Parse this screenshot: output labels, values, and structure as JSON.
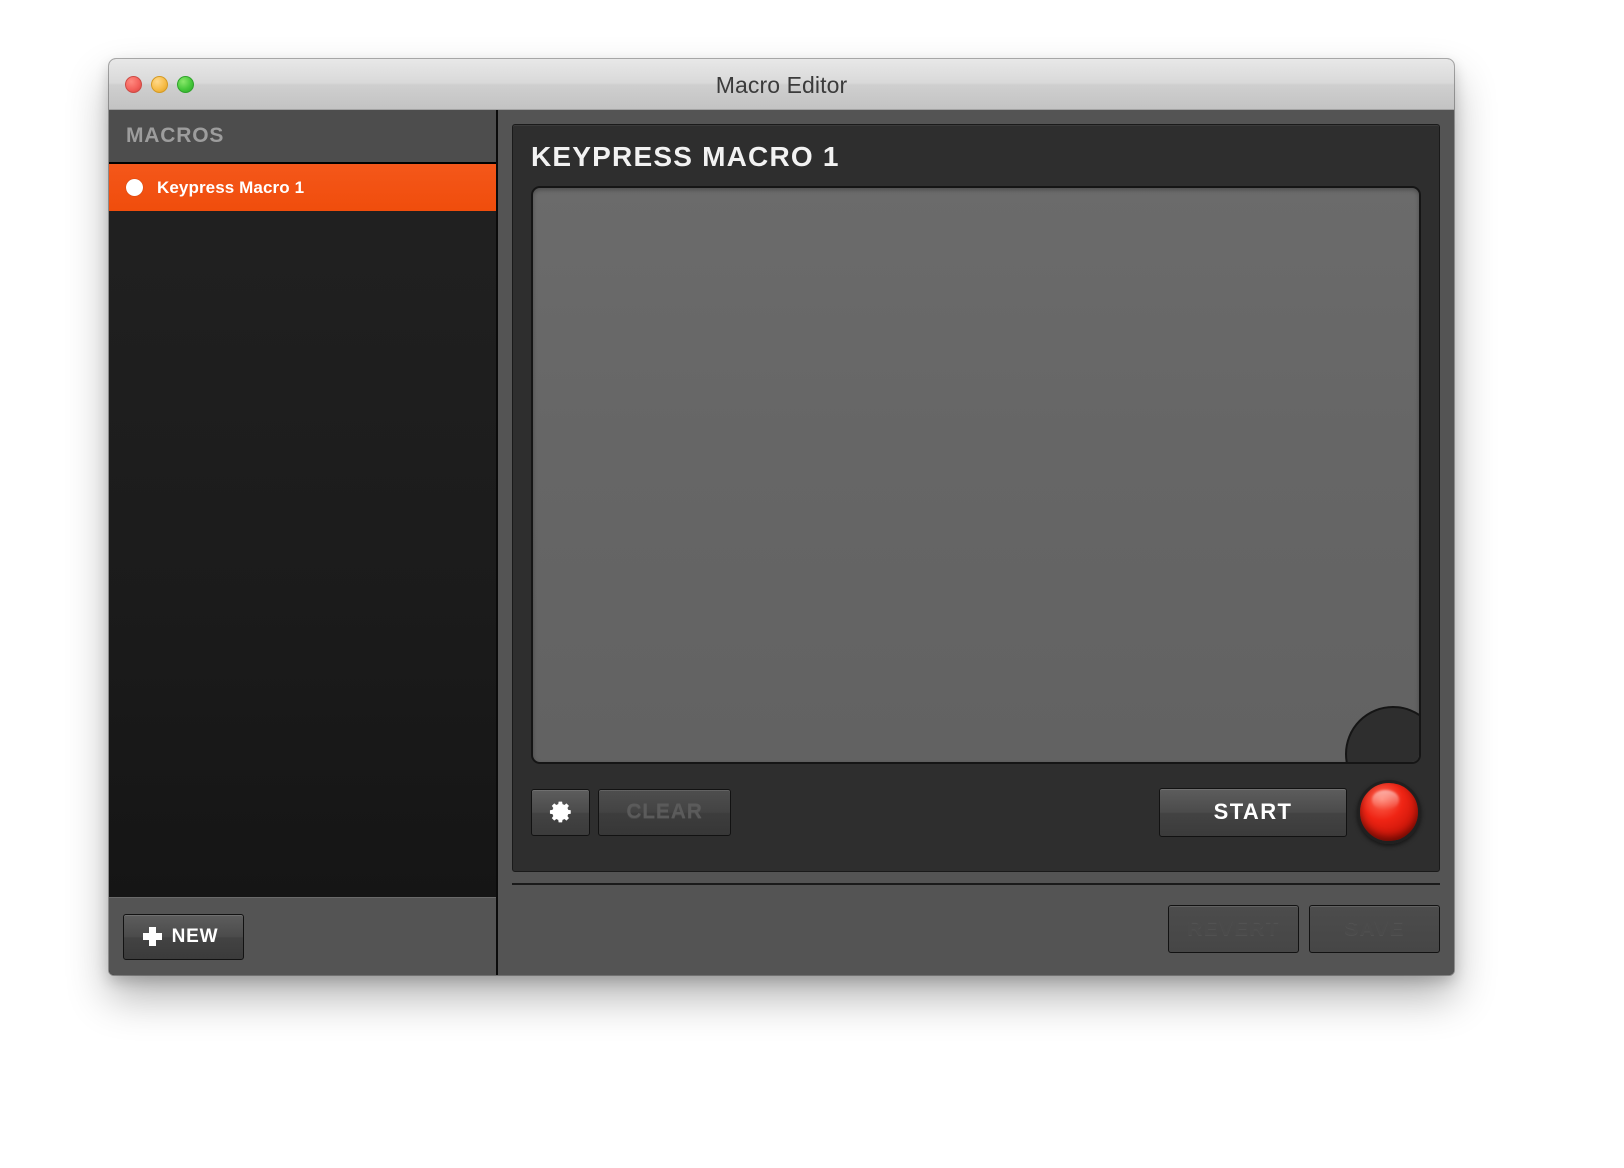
{
  "window": {
    "title": "Macro Editor",
    "traffic_lights": [
      {
        "name": "close",
        "color": "#f4625c"
      },
      {
        "name": "minimize",
        "color": "#f7bd4a"
      },
      {
        "name": "maximize",
        "color": "#47c83b"
      }
    ]
  },
  "sidebar": {
    "header_label": "MACROS",
    "items": [
      {
        "label": "Keypress Macro 1",
        "selected": true,
        "icon": "circle-dot-icon"
      }
    ],
    "new_button": {
      "label": "NEW",
      "icon": "plus-icon"
    },
    "selected_color": "#f04d0c"
  },
  "main": {
    "panel_title": "KEYPRESS MACRO 1",
    "content_area": {
      "text": "",
      "background": "#666666"
    },
    "toolbar": {
      "settings_button": {
        "label": "",
        "icon": "gear-icon",
        "enabled": true
      },
      "clear_button": {
        "label": "CLEAR",
        "enabled": false
      },
      "start_button": {
        "label": "START",
        "enabled": true
      },
      "record_button": {
        "label": "",
        "icon": "record-circle-icon",
        "color": "#ef2414",
        "enabled": true
      }
    }
  },
  "footer": {
    "revert_button": {
      "label": "REVERT",
      "enabled": false
    },
    "save_button": {
      "label": "SAVE",
      "enabled": false
    }
  }
}
